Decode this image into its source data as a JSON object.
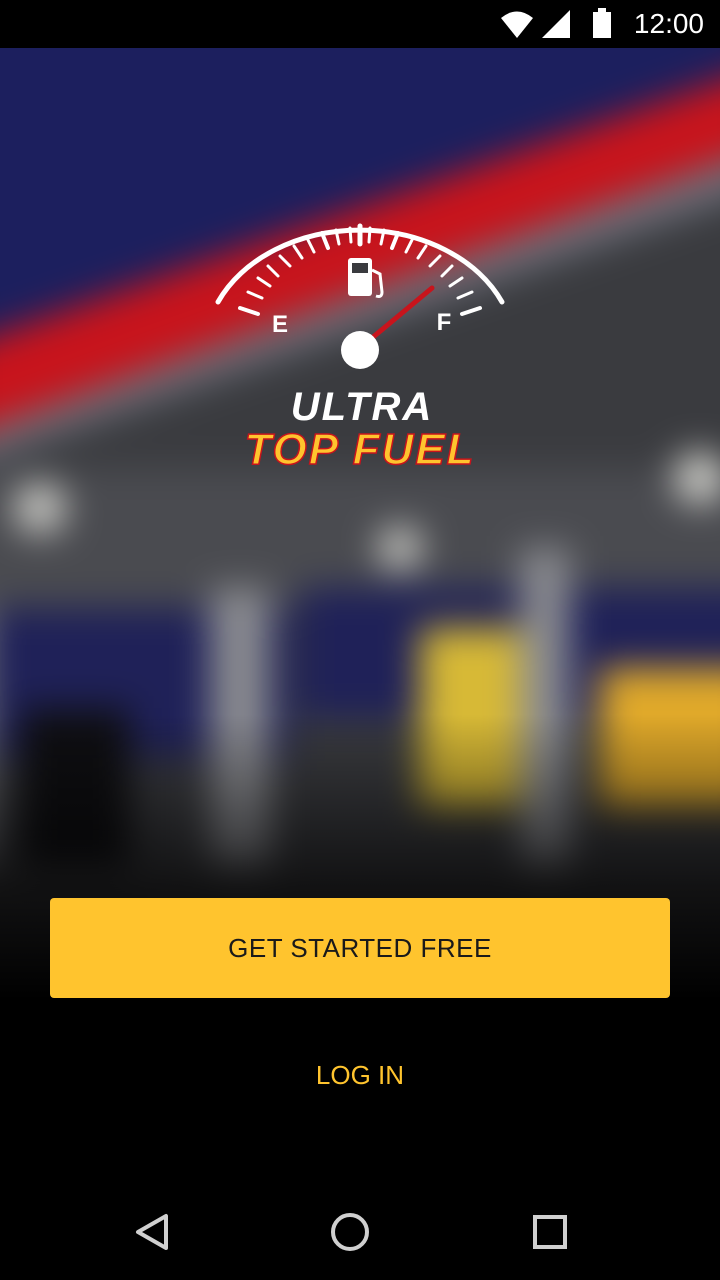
{
  "status_bar": {
    "time": "12:00"
  },
  "logo": {
    "gauge_empty_label": "E",
    "gauge_full_label": "F",
    "brand_line1": "ULTRA",
    "brand_line2": "TOP FUEL"
  },
  "actions": {
    "primary_label": "GET STARTED FREE",
    "secondary_label": "LOG IN"
  },
  "colors": {
    "accent": "#FFC42E",
    "brand_red": "#D0121B",
    "brand_navy": "#1C1F5E"
  },
  "icons": {
    "status": [
      "wifi-icon",
      "signal-icon",
      "battery-icon"
    ],
    "logo": [
      "fuel-pump-icon"
    ],
    "nav": [
      "back-icon",
      "home-icon",
      "recents-icon"
    ]
  }
}
